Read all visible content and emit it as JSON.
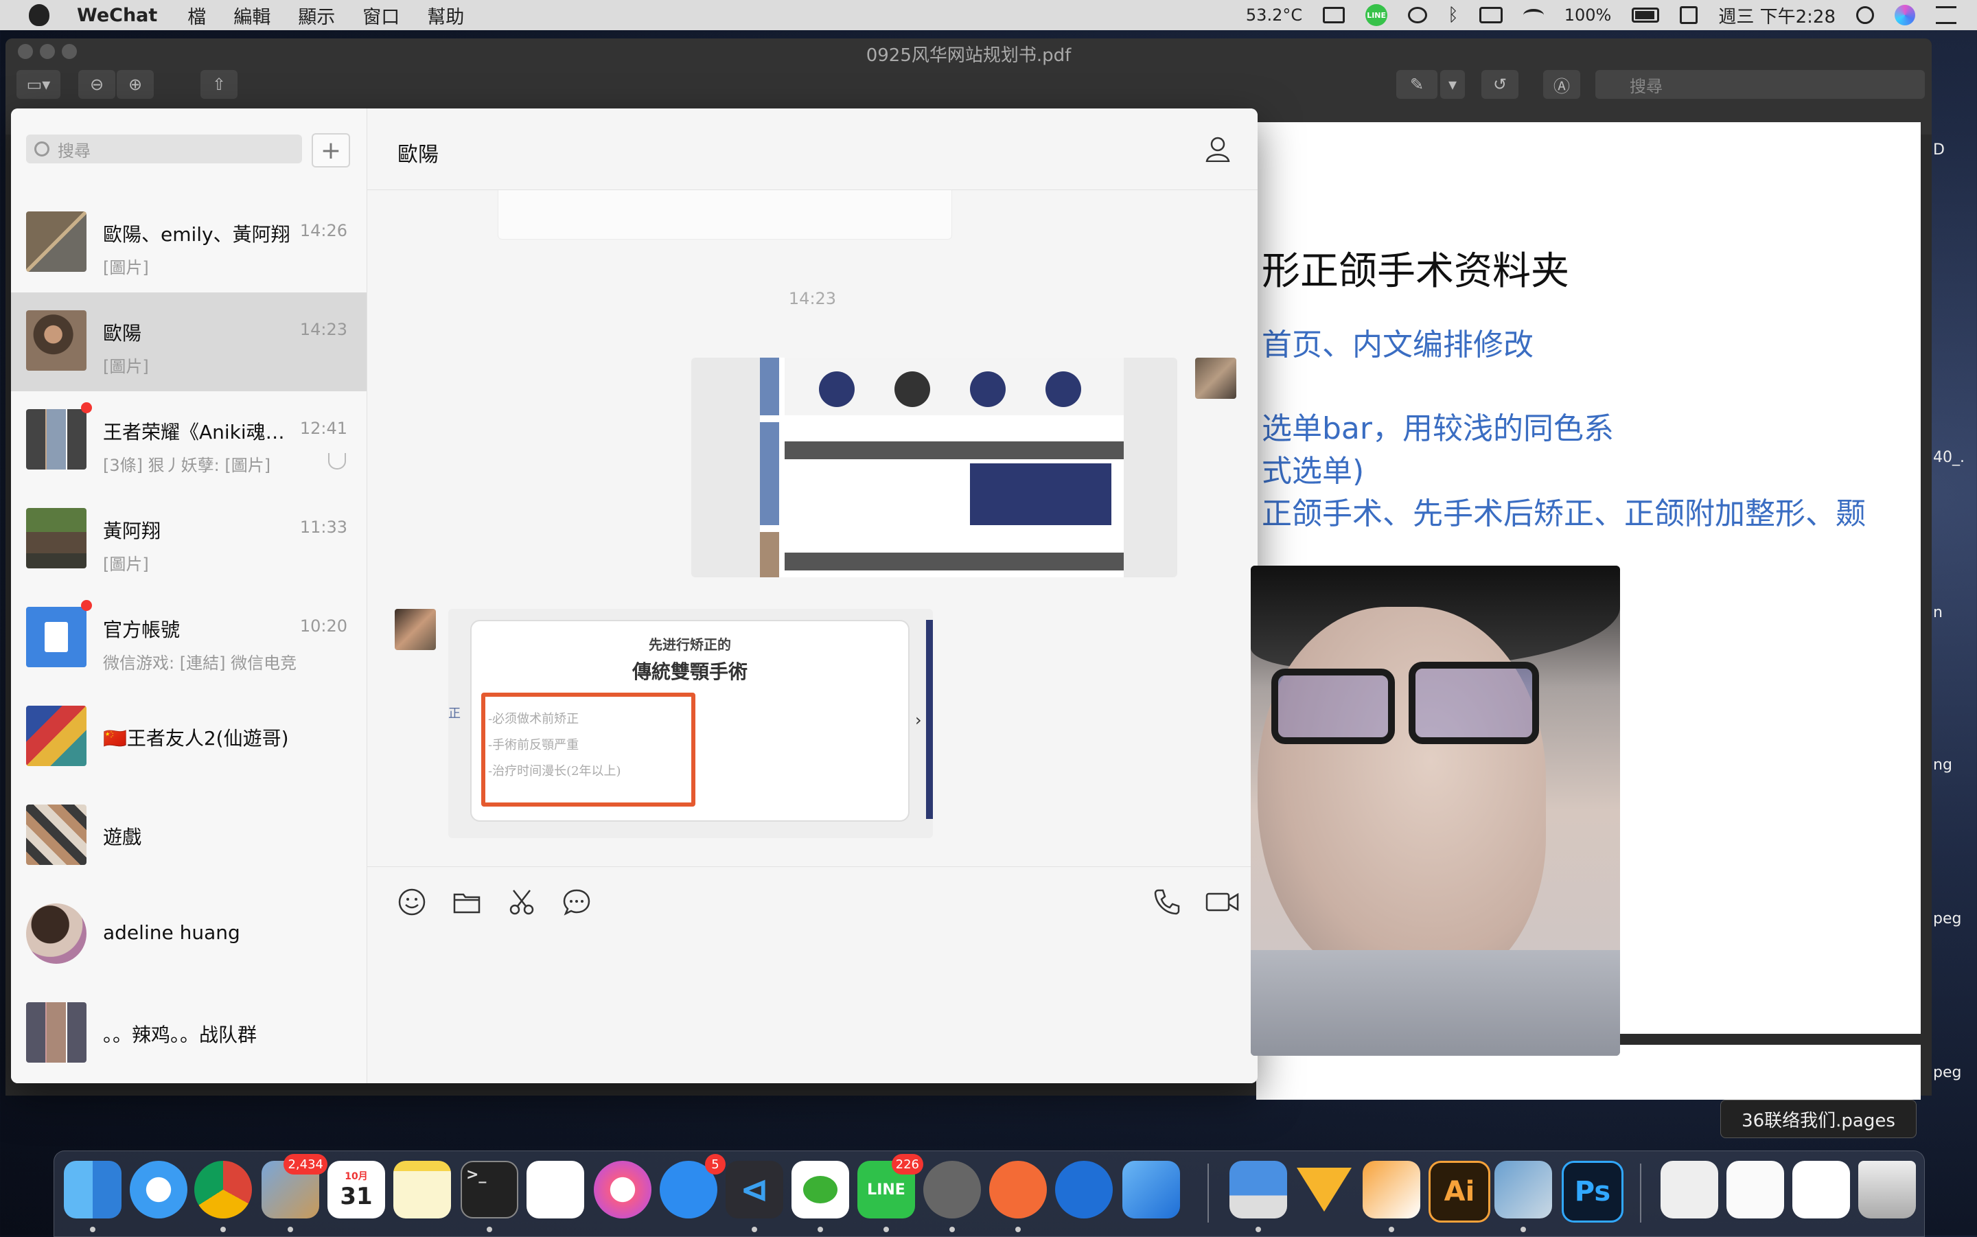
{
  "menubar": {
    "app_name": "WeChat",
    "menus": [
      "檔",
      "編輯",
      "顯示",
      "窗口",
      "幫助"
    ],
    "temperature": "53.2°C",
    "line_label": "LINE",
    "battery": "100%",
    "datetime": "週三 下午2:28"
  },
  "preview": {
    "title": "0925风华网站规划书.pdf",
    "search_placeholder": "搜尋",
    "pdf_heading": "形正颌手术资料夹",
    "pdf_lines": [
      "首页、内文编排修改",
      "选单bar，用较浅的同色系",
      "式选单)",
      "正颌手术、先手术后矫正、正颌附加整形、颞"
    ],
    "side_labels": [
      "D",
      "40_.",
      "n",
      "ng",
      "peg",
      "peg"
    ]
  },
  "wechat": {
    "search_placeholder": "搜尋",
    "add_label": "+",
    "chats": [
      {
        "name": "歐陽、emily、黃阿翔",
        "time": "14:26",
        "preview": "[圖片]"
      },
      {
        "name": "歐陽",
        "time": "14:23",
        "preview": "[圖片]"
      },
      {
        "name": "王者荣耀《Aniki魂…",
        "time": "12:41",
        "preview": "[3條] 狠丿妖孽: [圖片]"
      },
      {
        "name": "黃阿翔",
        "time": "11:33",
        "preview": "[圖片]"
      },
      {
        "name": "官方帳號",
        "time": "10:20",
        "preview": "微信游戏: [連結] 微信电竞"
      },
      {
        "name": "🇨🇳王者友人2(仙遊哥)",
        "time": "",
        "preview": ""
      },
      {
        "name": "遊戲",
        "time": "",
        "preview": ""
      },
      {
        "name": "adeline huang",
        "time": "",
        "preview": ""
      },
      {
        "name": "。。辣鸡。。战队群",
        "time": "",
        "preview": ""
      }
    ],
    "chat_title": "歐陽",
    "timestamp": "14:23",
    "slide": {
      "subtitle": "先进行矫正的",
      "title": "傳統雙顎手術",
      "items": [
        "-必须做术前矫正",
        "-手術前反顎严重",
        "-治疗时间漫长(2年以上)"
      ],
      "side_char": "正"
    }
  },
  "tooltip": "36联络我们.pages",
  "dock": {
    "badges": {
      "mail": "2,434",
      "calendar_month": "10月",
      "calendar_day": "31",
      "appstore": "5",
      "line": "226"
    },
    "labels": {
      "line": "LINE",
      "illustrator": "Ai",
      "photoshop": "Ps"
    }
  },
  "colors": {
    "accent_red": "#e55a2f",
    "badge_red": "#f43530",
    "pdf_blue": "#3a6dc2",
    "selected_bg": "#d9d9d9"
  }
}
